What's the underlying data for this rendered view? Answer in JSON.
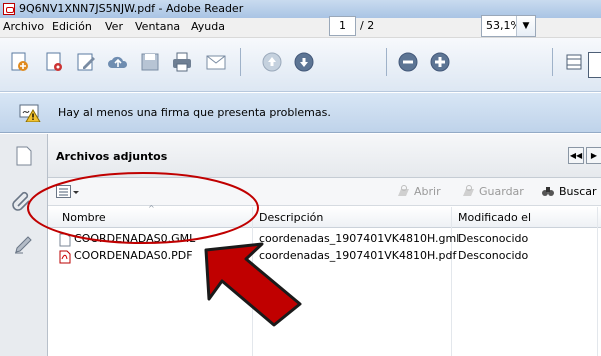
{
  "window": {
    "title": "9Q6NV1XNN7JS5NJW.pdf - Adobe Reader"
  },
  "menu": [
    "Archivo",
    "Edición",
    "Ver",
    "Ventana",
    "Ayuda"
  ],
  "toolbar": {
    "page_current": "1",
    "page_total": "/ 2",
    "zoom": "53,1%"
  },
  "signature_bar": {
    "message": "Hay al menos una firma que presenta problemas."
  },
  "attachments": {
    "title": "Archivos adjuntos",
    "actions": {
      "open": "Abrir",
      "save": "Guardar",
      "search": "Buscar"
    },
    "columns": {
      "name": "Nombre",
      "description": "Descripción",
      "modified": "Modificado el"
    },
    "rows": [
      {
        "name": "COORDENADAS0.GML",
        "description": "coordenadas_1907401VK4810H.gml",
        "modified": "Desconocido",
        "type": "gml"
      },
      {
        "name": "COORDENADAS0.PDF",
        "description": "coordenadas_1907401VK4810H.pdf",
        "modified": "Desconocido",
        "type": "pdf"
      }
    ]
  },
  "colors": {
    "accent": "#3a6ea5",
    "annotation_red": "#c00000"
  }
}
